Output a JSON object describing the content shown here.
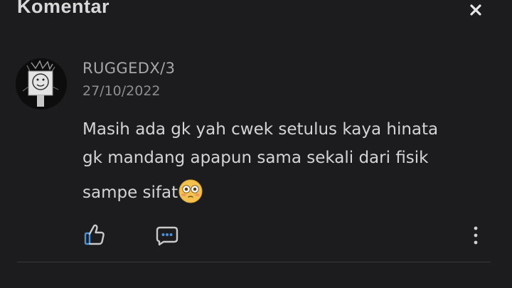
{
  "header": {
    "title": "Komentar",
    "close_icon": "close-icon"
  },
  "comment": {
    "avatar_icon": "avatar",
    "username": "RUGGEDX/3",
    "date": "27/10/2022",
    "lines": [
      "Masih ada gk yah cwek setulus kaya hinata",
      "gk mandang apapun sama sekali dari fisik",
      "sampe sifat"
    ],
    "emoji": "flushed-face-emoji"
  },
  "actions": {
    "like_icon": "thumbs-up-icon",
    "reply_icon": "chat-bubble-icon",
    "more_icon": "more-vertical-icon"
  },
  "colors": {
    "background": "#1c1c1e",
    "text_primary": "#d4d4d4",
    "text_secondary": "#8e8e8e",
    "accent_blue": "#4a90d9",
    "emoji_yellow": "#f2c14e"
  }
}
